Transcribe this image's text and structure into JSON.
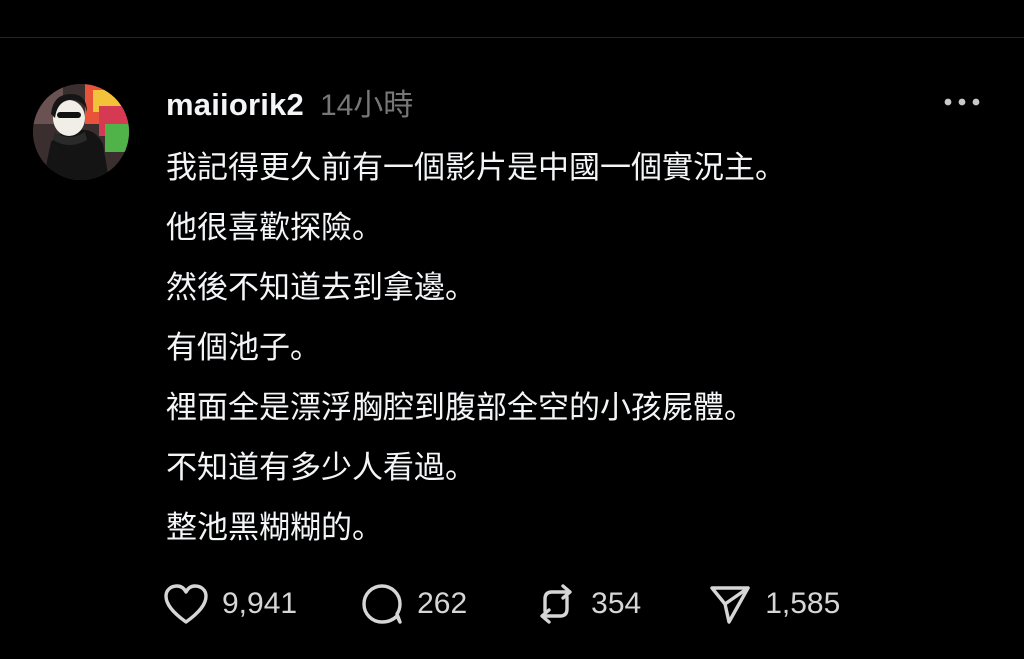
{
  "post": {
    "username": "maiiorik2",
    "timestamp": "14小時",
    "lines": [
      "我記得更久前有一個影片是中國一個實況主。",
      "他很喜歡探險。",
      "然後不知道去到拿邊。",
      "有個池子。",
      "裡面全是漂浮胸腔到腹部全空的小孩屍體。",
      "不知道有多少人看過。",
      "整池黑糊糊的。"
    ],
    "actions": {
      "likes": "9,941",
      "replies": "262",
      "reposts": "354",
      "shares": "1,585"
    }
  },
  "icons": {
    "more": "more-horizontal-icon",
    "like": "heart-icon",
    "reply": "speech-bubble-icon",
    "repost": "repost-icon",
    "share": "send-icon"
  },
  "colors": {
    "background": "#000000",
    "text_primary": "#f3f5f7",
    "text_secondary": "#777777",
    "action_text": "#d6d6d6"
  }
}
